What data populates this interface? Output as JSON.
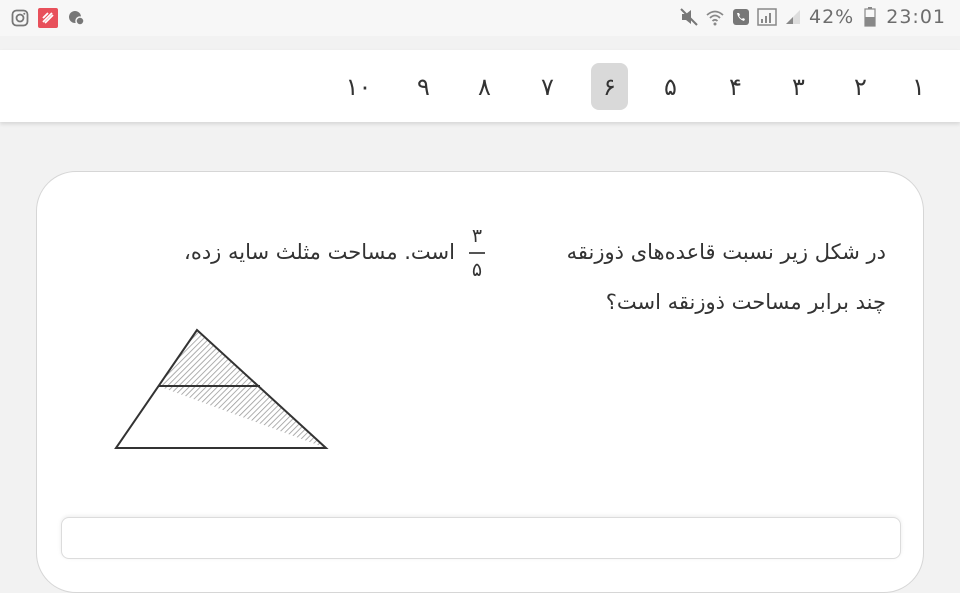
{
  "status_bar": {
    "left_icons": [
      "instagram-icon",
      "app-icon",
      "cloud-icon"
    ],
    "right_icons": [
      "mute-icon",
      "wifi-icon",
      "phone-icon",
      "signal-icon",
      "signal-weak-icon",
      "battery-icon"
    ],
    "battery": "42%",
    "time": "23:01"
  },
  "question_nav": {
    "items": [
      "۱",
      "۲",
      "۳",
      "۴",
      "۵",
      "۶",
      "۷",
      "۸",
      "۹",
      "۱۰"
    ],
    "active_index": 5
  },
  "question": {
    "line1_part1": "در شکل زیر نسبت قاعده‌های ذوزنقه",
    "line1_part2": "است. مساحت مثلث سایه زده،",
    "line2": "چند برابر مساحت ذوزنقه است؟",
    "fraction": {
      "numerator": "۳",
      "denominator": "۵"
    }
  },
  "colors": {
    "active_tab": "#d9d9d9",
    "text": "#333333"
  }
}
